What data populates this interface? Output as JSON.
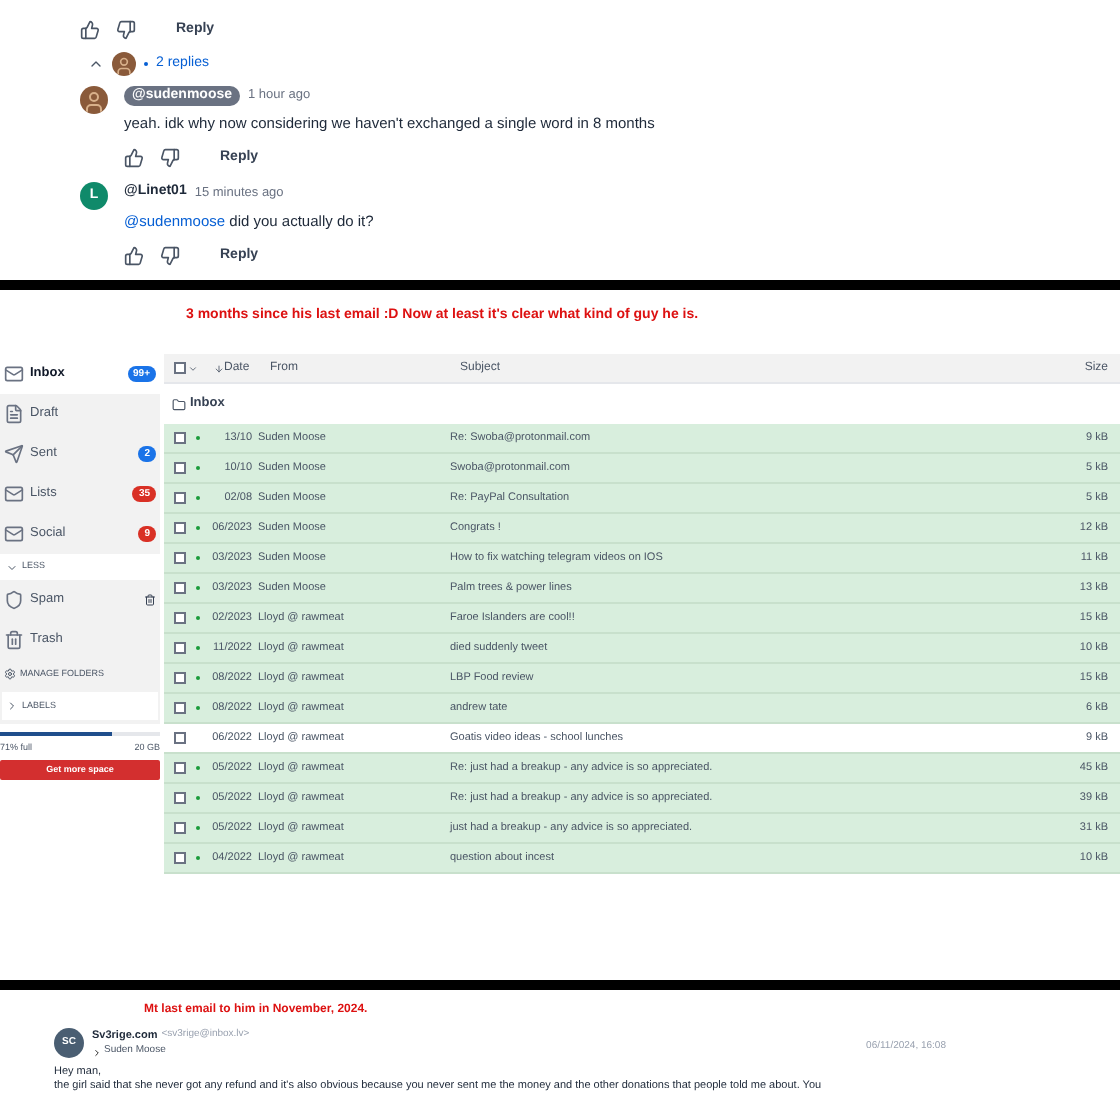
{
  "comment_thread": {
    "top_reply_label": "Reply",
    "replies_toggle": {
      "label": "2 replies",
      "expanded": true
    },
    "replies": [
      {
        "kind": "creator",
        "author": "@sudenmoose",
        "time": "1 hour ago",
        "text": "yeah. idk why now considering we haven't exchanged a single word in 8 months",
        "reply_label": "Reply"
      },
      {
        "kind": "user",
        "avatar_letter": "L",
        "color": "#0f8a6a",
        "author": "@Linet01",
        "time": "15 minutes ago",
        "mention": "@sudenmoose",
        "text": "did you actually do it?",
        "reply_label": "Reply"
      }
    ]
  },
  "mail_section": {
    "caption": "3 months since his last email :D Now at least it's clear what kind of guy he is.",
    "sidebar": {
      "folders": [
        {
          "label": "Inbox",
          "badge": "99+",
          "color": "#1a73e8",
          "selected": true
        },
        {
          "label": "Draft",
          "selected": false
        },
        {
          "label": "Sent",
          "badge": "2",
          "color": "#1a73e8",
          "selected": false
        },
        {
          "label": "Lists",
          "badge": "35",
          "color": "#d93025",
          "selected": false
        },
        {
          "label": "Social",
          "badge": "9",
          "color": "#d93025",
          "selected": false
        }
      ],
      "less_toggle": "LESS",
      "extra_folders": [
        {
          "label": "Spam",
          "kind": "spam"
        },
        {
          "label": "Trash",
          "kind": "trash"
        }
      ],
      "manage_folders": "MANAGE FOLDERS",
      "labels": "LABELS",
      "storage": {
        "level": 0.7,
        "used": "71% full",
        "total": "20 GB"
      },
      "upgrade_button": "Get more space"
    },
    "table": {
      "select_all_checked": false,
      "columns": [
        "Date",
        "From",
        "Subject",
        "Size"
      ],
      "folder": "Inbox",
      "rows": [
        {
          "date": "13/10",
          "from": "Suden Moose",
          "subject": "Re: Swoba@protonmail.com",
          "size": "9 kB",
          "unread": true,
          "checked": false
        },
        {
          "date": "10/10",
          "from": "Suden Moose",
          "subject": "Swoba@protonmail.com",
          "size": "5 kB",
          "unread": true,
          "checked": false
        },
        {
          "date": "02/08",
          "from": "Suden Moose",
          "subject": "Re: PayPal Consultation",
          "size": "5 kB",
          "unread": true,
          "checked": false
        },
        {
          "date": "06/2023",
          "from": "Suden Moose",
          "subject": "Congrats !",
          "size": "12 kB",
          "unread": true,
          "checked": false
        },
        {
          "date": "03/2023",
          "from": "Suden Moose",
          "subject": "How to fix watching telegram videos on IOS",
          "size": "11 kB",
          "unread": true,
          "checked": false
        },
        {
          "date": "03/2023",
          "from": "Suden Moose",
          "subject": "Palm trees & power lines",
          "size": "13 kB",
          "unread": true,
          "checked": false
        },
        {
          "date": "02/2023",
          "from": "Lloyd @ rawmeat",
          "subject": "Faroe Islanders are cool!!",
          "size": "15 kB",
          "unread": true,
          "checked": false
        },
        {
          "date": "11/2022",
          "from": "Lloyd @ rawmeat",
          "subject": "died suddenly tweet",
          "size": "10 kB",
          "unread": true,
          "checked": false
        },
        {
          "date": "08/2022",
          "from": "Lloyd @ rawmeat",
          "subject": "LBP Food review",
          "size": "15 kB",
          "unread": true,
          "checked": false
        },
        {
          "date": "08/2022",
          "from": "Lloyd @ rawmeat",
          "subject": "andrew tate",
          "size": "6 kB",
          "unread": true,
          "checked": false
        },
        {
          "date": "06/2022",
          "from": "Lloyd @ rawmeat",
          "subject": "Goatis video ideas - school lunches",
          "size": "9 kB",
          "unread": false,
          "checked": false
        },
        {
          "date": "05/2022",
          "from": "Lloyd @ rawmeat",
          "subject": "Re: just had a breakup - any advice is so appreciated.",
          "size": "45 kB",
          "unread": true,
          "checked": false
        },
        {
          "date": "05/2022",
          "from": "Lloyd @ rawmeat",
          "subject": "Re: just had a breakup - any advice is so appreciated.",
          "size": "39 kB",
          "unread": true,
          "checked": false
        },
        {
          "date": "05/2022",
          "from": "Lloyd @ rawmeat",
          "subject": "just had a breakup - any advice is so appreciated.",
          "size": "31 kB",
          "unread": true,
          "checked": false
        },
        {
          "date": "04/2022",
          "from": "Lloyd @ rawmeat",
          "subject": "question about incest",
          "size": "10 kB",
          "unread": true,
          "checked": false
        }
      ]
    }
  },
  "last_email_section": {
    "caption": "Mt last email to him in November, 2024.",
    "email": {
      "avatar_initials": "SC",
      "sender": "Sv3rige.com",
      "address": "<sv3rige@inbox.lv>",
      "recipient": "Suden Moose",
      "date": "06/11/2024, 16:08",
      "body": [
        "Hey man,",
        "the girl said that she never got any refund and it's also obvious because you never sent me the money and the other donations that people told me about. You"
      ]
    }
  }
}
